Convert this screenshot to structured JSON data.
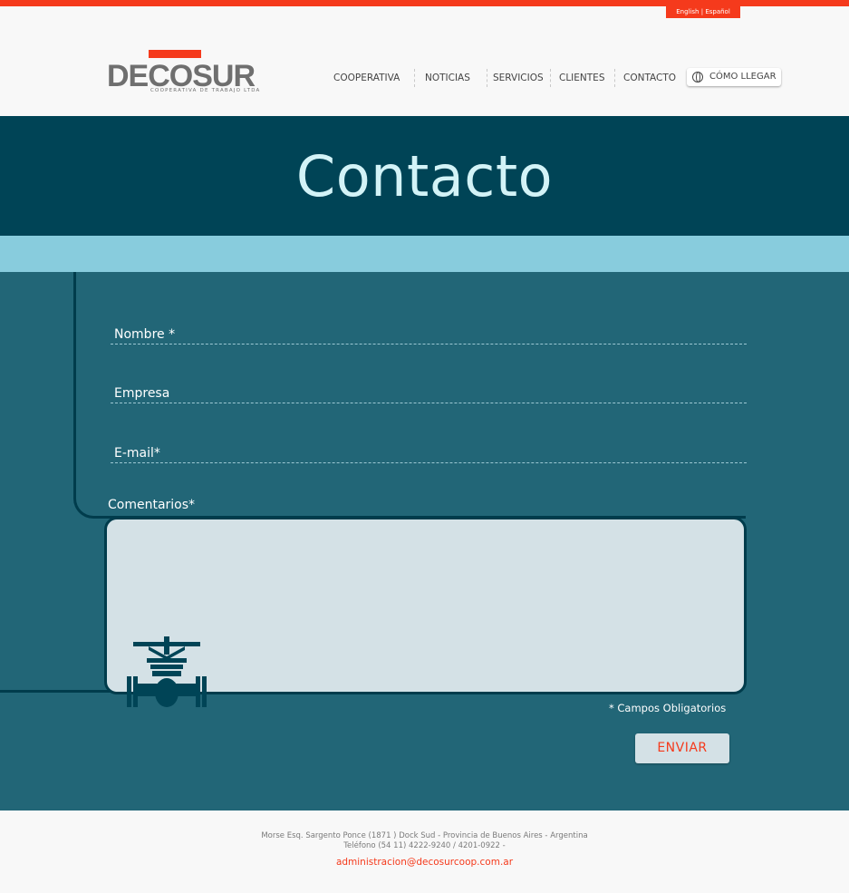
{
  "lang": {
    "english": "English",
    "separator": "|",
    "espanol": "Español"
  },
  "logo": {
    "brand": "DECOSUR",
    "tagline": "COOPERATIVA DE TRABAJO LTDA"
  },
  "nav": {
    "items": [
      "COOPERATIVA",
      "NOTICIAS",
      "SERVICIOS",
      "CLIENTES",
      "CONTACTO"
    ],
    "como_llegar": "CÓMO LLEGAR"
  },
  "page": {
    "title": "Contacto"
  },
  "form": {
    "nombre_label": "Nombre *",
    "empresa_label": "Empresa",
    "email_label": "E-mail*",
    "comentarios_label": "Comentarios*",
    "obligatorios_note": "* Campos Obligatorios",
    "submit_label": "ENVIAR"
  },
  "footer": {
    "address_line1": "Morse Esq. Sargento Ponce (1871 ) Dock Sud - Provincia de Buenos Aires - Argentina",
    "address_line2": "Teléfono (54 11) 4222-9240 / 4201-0922 -",
    "email": "administracion@decosurcoop.com.ar"
  },
  "colors": {
    "accent": "#f53a1c",
    "dark_teal": "#004456",
    "light_blue": "#88ccdd",
    "form_bg": "#226677"
  }
}
